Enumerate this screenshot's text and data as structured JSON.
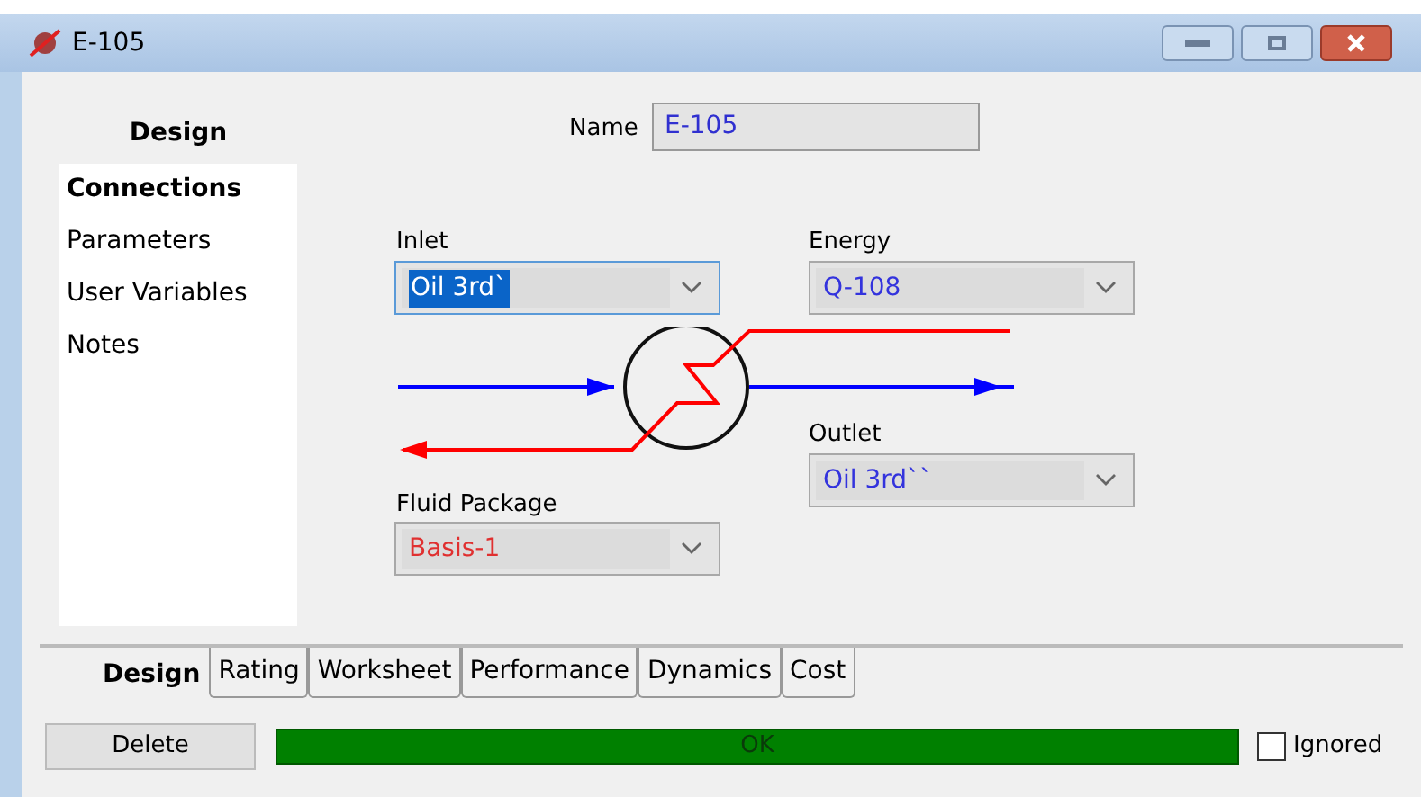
{
  "window": {
    "title": "E-105"
  },
  "name_field": {
    "label": "Name",
    "value": "E-105"
  },
  "sidebar": {
    "header": "Design",
    "items": [
      {
        "label": "Connections",
        "selected": true
      },
      {
        "label": "Parameters",
        "selected": false
      },
      {
        "label": "User Variables",
        "selected": false
      },
      {
        "label": "Notes",
        "selected": false
      }
    ]
  },
  "connections": {
    "inlet": {
      "label": "Inlet",
      "value": "Oil 3rd`",
      "focused": true
    },
    "energy": {
      "label": "Energy",
      "value": "Q-108",
      "kind": "stream",
      "focused": false
    },
    "outlet": {
      "label": "Outlet",
      "value": "Oil 3rd``",
      "kind": "stream",
      "focused": false
    },
    "fluid_package": {
      "label": "Fluid Package",
      "value": "Basis-1",
      "kind": "package",
      "focused": false
    }
  },
  "tabs": [
    {
      "label": "Design",
      "selected": true
    },
    {
      "label": "Rating",
      "selected": false
    },
    {
      "label": "Worksheet",
      "selected": false
    },
    {
      "label": "Performance",
      "selected": false
    },
    {
      "label": "Dynamics",
      "selected": false
    },
    {
      "label": "Cost",
      "selected": false
    }
  ],
  "delete_button": "Delete",
  "status": {
    "text": "OK"
  },
  "ignored": {
    "label": "Ignored",
    "checked": false
  }
}
